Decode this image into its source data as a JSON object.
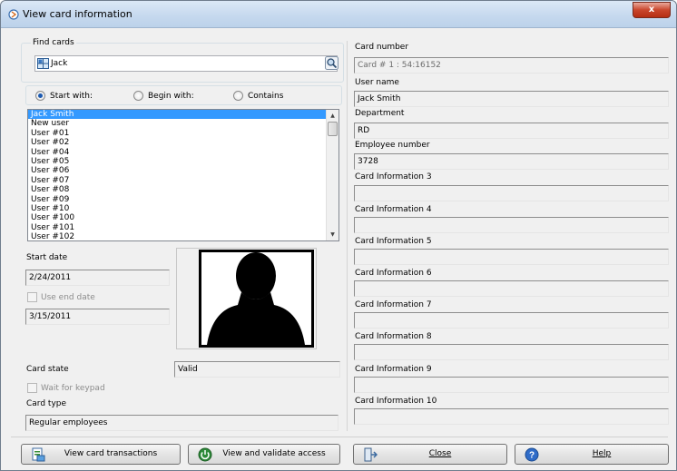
{
  "window": {
    "title": "View card information",
    "close_glyph": "x"
  },
  "find_cards": {
    "group_label": "Find cards",
    "search_value": "Jack",
    "radios": [
      {
        "label": "Start with:",
        "checked": true
      },
      {
        "label": "Begin with:",
        "checked": false
      },
      {
        "label": "Contains",
        "checked": false
      }
    ]
  },
  "user_list": {
    "items": [
      "Jack Smith",
      "New user",
      "User #01",
      "User #02",
      "User #04",
      "User #05",
      "User #06",
      "User #07",
      "User #08",
      "User #09",
      "User #10",
      "User #100",
      "User #101",
      "User #102"
    ],
    "selected_index": 0
  },
  "dates": {
    "start_date_label": "Start date",
    "start_date_value": "2/24/2011",
    "use_end_date_label": "Use end date",
    "end_date_value": "3/15/2011"
  },
  "card_state": {
    "label": "Card state",
    "value": "Valid",
    "wait_keypad_label": "Wait for keypad",
    "card_type_label": "Card type",
    "card_type_value": "Regular employees"
  },
  "card_details": {
    "card_number_label": "Card number",
    "card_number_value": "Card # 1 : 54:16152",
    "user_name_label": "User name",
    "user_name_value": "Jack Smith",
    "department_label": "Department",
    "department_value": "RD",
    "employee_number_label": "Employee number",
    "employee_number_value": "3728",
    "info3_label": "Card Information 3",
    "info3_value": "",
    "info4_label": "Card Information 4",
    "info4_value": "",
    "info5_label": "Card Information 5",
    "info5_value": "",
    "info6_label": "Card Information 6",
    "info6_value": "",
    "info7_label": "Card Information 7",
    "info7_value": "",
    "info8_label": "Card Information 8",
    "info8_value": "",
    "info9_label": "Card Information 9",
    "info9_value": "",
    "info10_label": "Card Information 10",
    "info10_value": ""
  },
  "buttons": {
    "transactions": "View card transactions",
    "validate": "View and validate access",
    "close": "Close",
    "help": "Help"
  },
  "icons": {
    "title": "keycard-icon",
    "search_field": "grid-icon",
    "search_button": "magnifier-icon",
    "transactions": "report-icon",
    "validate": "power-icon",
    "close": "exit-door-icon",
    "help": "help-icon"
  },
  "colors": {
    "selection": "#3399ff",
    "titlebar": "#c5d8ee",
    "close_button": "#c9462c"
  }
}
